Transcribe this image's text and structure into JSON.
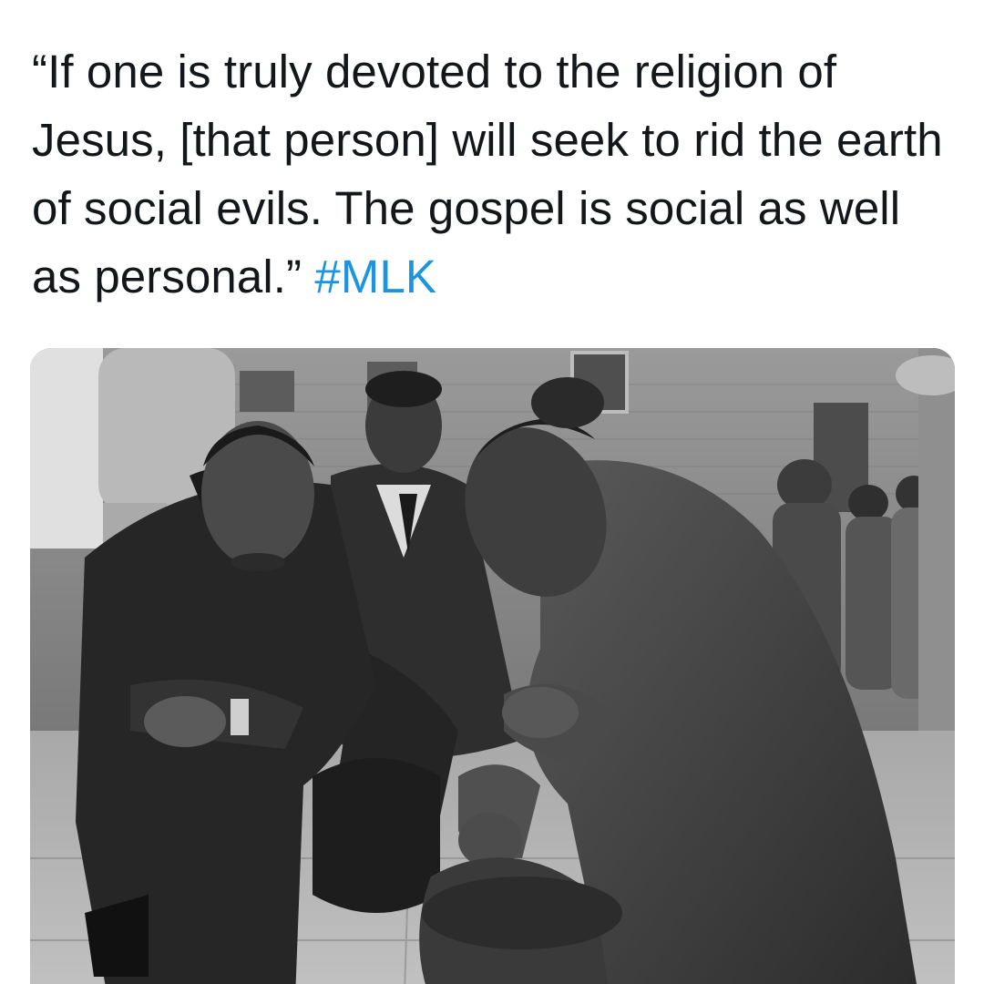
{
  "tweet": {
    "text": "“If one is truly devoted to the religion of Jesus, [that person] will seek to rid the earth of social evils. The gospel is social as well as personal.”",
    "hashtag": "#MLK"
  },
  "media": {
    "type": "photo",
    "style": "black-and-white"
  },
  "colors": {
    "text": "#14171a",
    "hashtag": "#1b95e0",
    "background": "#ffffff"
  }
}
